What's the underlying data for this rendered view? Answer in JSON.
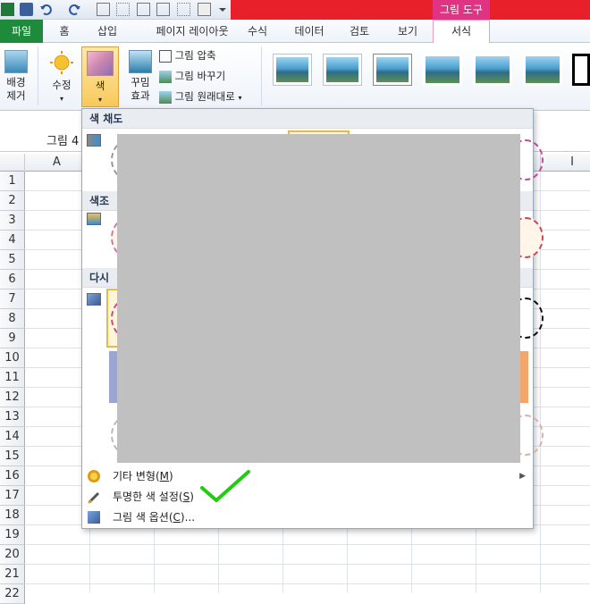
{
  "ribbon_tabs": {
    "context_group": "그림 도구",
    "file": "파일",
    "home": "홈",
    "insert": "삽입",
    "page_layout": "페이지 레이아웃",
    "formulas": "수식",
    "data": "데이터",
    "review": "검토",
    "view": "보기",
    "format": "서식"
  },
  "ribbon": {
    "remove_background": [
      "배경",
      "제거"
    ],
    "corrections": "수정",
    "color": "색",
    "artistic_effects": [
      "꾸밈",
      "효과"
    ],
    "compress_pictures": "그림 압축",
    "change_picture": "그림 바꾸기",
    "reset_picture": "그림 원래대로"
  },
  "name_box": "그림 4",
  "columns": [
    "A",
    "I"
  ],
  "rows": [
    "1",
    "2",
    "3",
    "4",
    "5",
    "6",
    "7",
    "8",
    "9",
    "10",
    "11",
    "12",
    "13",
    "14",
    "15",
    "16",
    "17",
    "18",
    "19",
    "20",
    "21",
    "22"
  ],
  "dropdown": {
    "sections": {
      "saturation": "색 채도",
      "tone": "색조",
      "recolor": "다시"
    },
    "menu_items": [
      {
        "label": "기타 변형",
        "accel": "M",
        "has_submenu": true
      },
      {
        "label": "투명한 색 설정",
        "accel": "S",
        "has_submenu": false
      },
      {
        "label": "그림 색 옵션",
        "accel": "C",
        "suffix": "..."
      }
    ]
  },
  "colors": {
    "file_tab": "#1e8a3b",
    "context_tab": "#e13384",
    "title_band": "#e8202a",
    "checkmark": "#22cc11",
    "selected_thumb": "#e8b84a"
  }
}
